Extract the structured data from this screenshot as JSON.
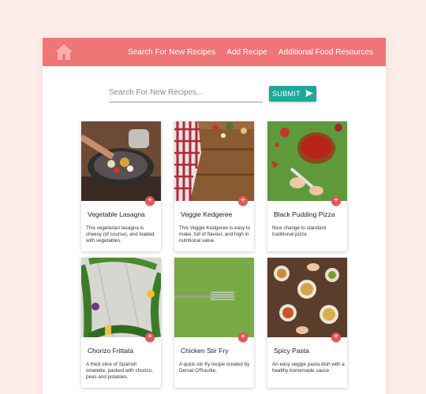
{
  "nav": {
    "home_icon": "home-icon",
    "links": [
      {
        "label": "Search For New Recipes"
      },
      {
        "label": "Add Recipe"
      },
      {
        "label": "Additional Food Resources"
      }
    ]
  },
  "search": {
    "placeholder": "Search For New Recipes...",
    "value": "",
    "submit_label": "SUBMIT",
    "submit_icon": "send-icon"
  },
  "colors": {
    "page_bg": "#fdece8",
    "navbar": "#ef7577",
    "submit": "#1fa79a",
    "add_button": "#e45555"
  },
  "recipes": [
    {
      "title": "Vegetable Lasagna",
      "description": "This vegetarian lasagna is cheesy (of course), and loaded with vegetables.",
      "add_icon": "plus-icon"
    },
    {
      "title": "Veggie Kedgeree",
      "description": "This Veggie Kedgeree is easy to make, full of flavour, and high in nutritional value.",
      "add_icon": "plus-icon"
    },
    {
      "title": "Black Pudding Pizza",
      "description": "Nice change to standard traditional pizza",
      "add_icon": "plus-icon"
    },
    {
      "title": "Chorizo Frittata",
      "description": "A thick slice of Spanish omelette, packed with chorizo, peas and potatoes.",
      "add_icon": "plus-icon"
    },
    {
      "title": "Chicken Stir Fry",
      "description": "A quick stir fry recipe created by Derval O'Rourke.",
      "add_icon": "plus-icon"
    },
    {
      "title": "Spicy Pasta",
      "description": "An easy veggie pasta dish with a healthy homemade sauce",
      "add_icon": "plus-icon"
    }
  ]
}
